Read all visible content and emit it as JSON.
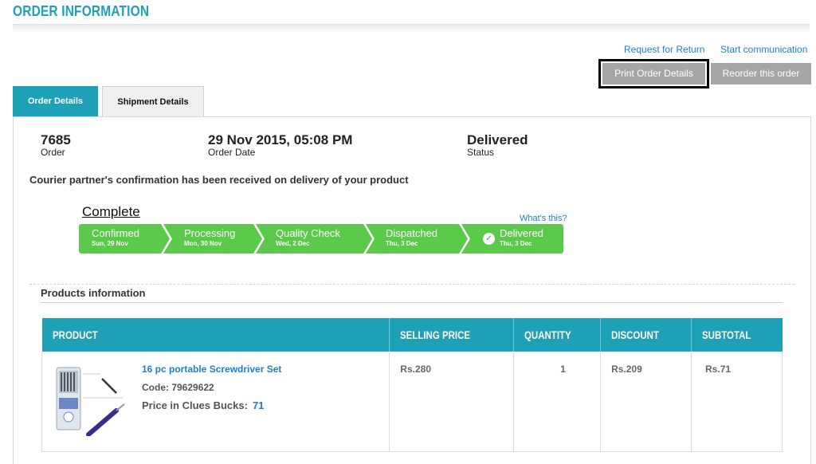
{
  "page": {
    "title": "ORDER INFORMATION"
  },
  "links": {
    "request_return": "Request for Return",
    "start_communication": "Start communication"
  },
  "actions": {
    "print": "Print Order Details",
    "reorder": "Reorder this order"
  },
  "tabs": [
    {
      "label": "Order Details",
      "active": true
    },
    {
      "label": "Shipment Details",
      "active": false
    }
  ],
  "summary": {
    "order_number": "7685",
    "order_label": "Order",
    "order_date": "29 Nov 2015, 05:08 PM",
    "order_date_label": "Order Date",
    "status": "Delivered",
    "status_label": "Status"
  },
  "courier_message": "Courier partner's confirmation has been received on delivery of your product",
  "tracking": {
    "heading": "Complete",
    "whats_this": "What's this?",
    "color": "#5bc94a",
    "steps": [
      {
        "name": "Confirmed",
        "date": "Sun, 29 Nov"
      },
      {
        "name": "Processing",
        "date": "Mon, 30 Nov"
      },
      {
        "name": "Quality Check",
        "date": "Wed, 2 Dec"
      },
      {
        "name": "Dispatched",
        "date": "Thu, 3 Dec"
      },
      {
        "name": "Delivered",
        "date": "Thu, 3 Dec",
        "icon": "check-circle-icon"
      }
    ]
  },
  "products": {
    "heading": "Products information",
    "columns": [
      "PRODUCT",
      "SELLING PRICE",
      "QUANTITY",
      "DISCOUNT",
      "SUBTOTAL"
    ],
    "rows": [
      {
        "name": "16 pc portable Screwdriver Set",
        "code": "Code: 79629622",
        "bucks_label": "Price in Clues Bucks:",
        "bucks_value": "71",
        "selling_price": "Rs.280",
        "quantity": "1",
        "discount": "Rs.209",
        "subtotal": "Rs.71"
      }
    ]
  },
  "colors": {
    "accent": "#1ea0b6",
    "link": "#1e7fc7",
    "button_gray": "#a6a6a6",
    "progress_green": "#5bc94a"
  }
}
